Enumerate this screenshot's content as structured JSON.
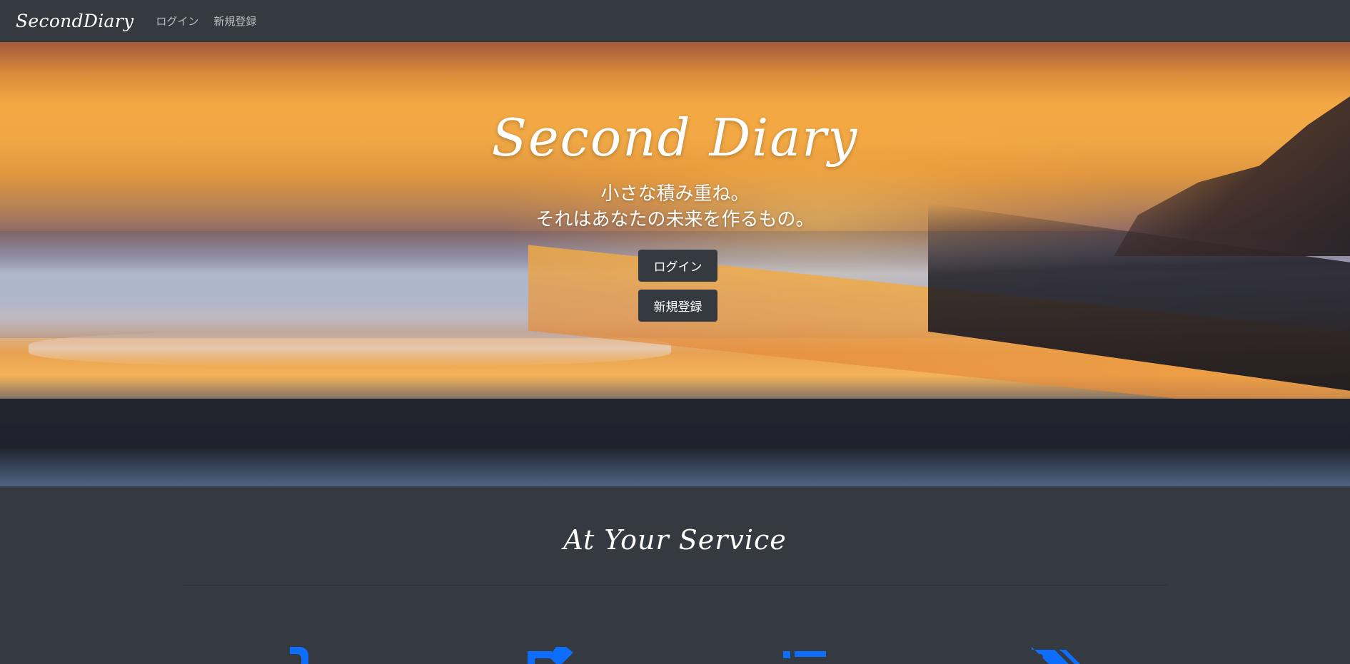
{
  "navbar": {
    "brand": "SecondDiary",
    "links": [
      "ログイン",
      "新規登録"
    ]
  },
  "hero": {
    "title": "Second Diary",
    "tagline_line1": "小さな積み重ね。",
    "tagline_line2": "それはあなたの未来を作るもの。",
    "login_button": "ログイン",
    "signup_button": "新規登録"
  },
  "services": {
    "title": "At Your Service",
    "icons": [
      "diary-icon",
      "edit-icon",
      "list-icon",
      "tag-icon"
    ]
  },
  "colors": {
    "navbar_bg": "#343a40",
    "page_bg": "#343a40",
    "icon_blue": "#0d6efd"
  }
}
